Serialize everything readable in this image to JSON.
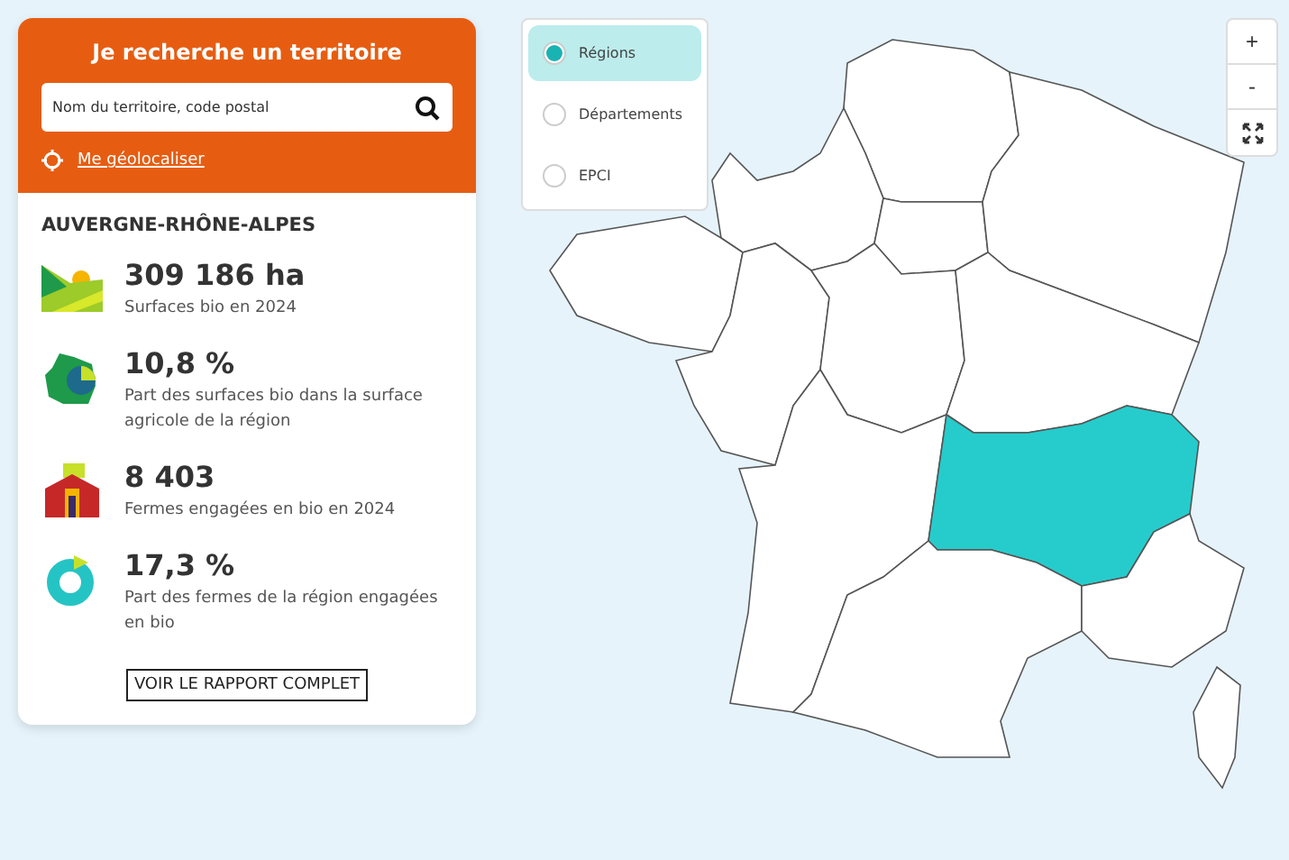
{
  "search": {
    "title": "Je recherche un territoire",
    "placeholder": "Nom du territoire, code postal",
    "geolocate": "Me géolocaliser"
  },
  "region": {
    "name": "AUVERGNE-RHÔNE-ALPES",
    "stats": [
      {
        "kind": "surface",
        "value": "309 186 ha",
        "label": "Surfaces bio en 2024"
      },
      {
        "kind": "share",
        "value": "10,8 %",
        "label": "Part des surfaces bio dans la surface agricole de la région"
      },
      {
        "kind": "farms",
        "value": "8 403",
        "label": "Fermes engagées en bio en 2024"
      },
      {
        "kind": "donut",
        "value": "17,3 %",
        "label": "Part des fermes de la région engagées en bio"
      }
    ],
    "report_button": "VOIR LE RAPPORT COMPLET"
  },
  "levels": [
    {
      "label": "Régions",
      "selected": true
    },
    {
      "label": "Départements",
      "selected": false
    },
    {
      "label": "EPCI",
      "selected": false
    }
  ],
  "zoom_controls": [
    "+",
    "-"
  ],
  "map": {
    "regions": [
      {
        "selected": false
      },
      {
        "selected": false
      },
      {
        "selected": false
      },
      {
        "selected": false
      },
      {
        "selected": false
      },
      {
        "selected": false
      },
      {
        "selected": false
      },
      {
        "selected": false
      },
      {
        "selected": false
      },
      {
        "selected": true
      },
      {
        "selected": false
      },
      {
        "selected": false
      },
      {
        "selected": false
      }
    ]
  }
}
